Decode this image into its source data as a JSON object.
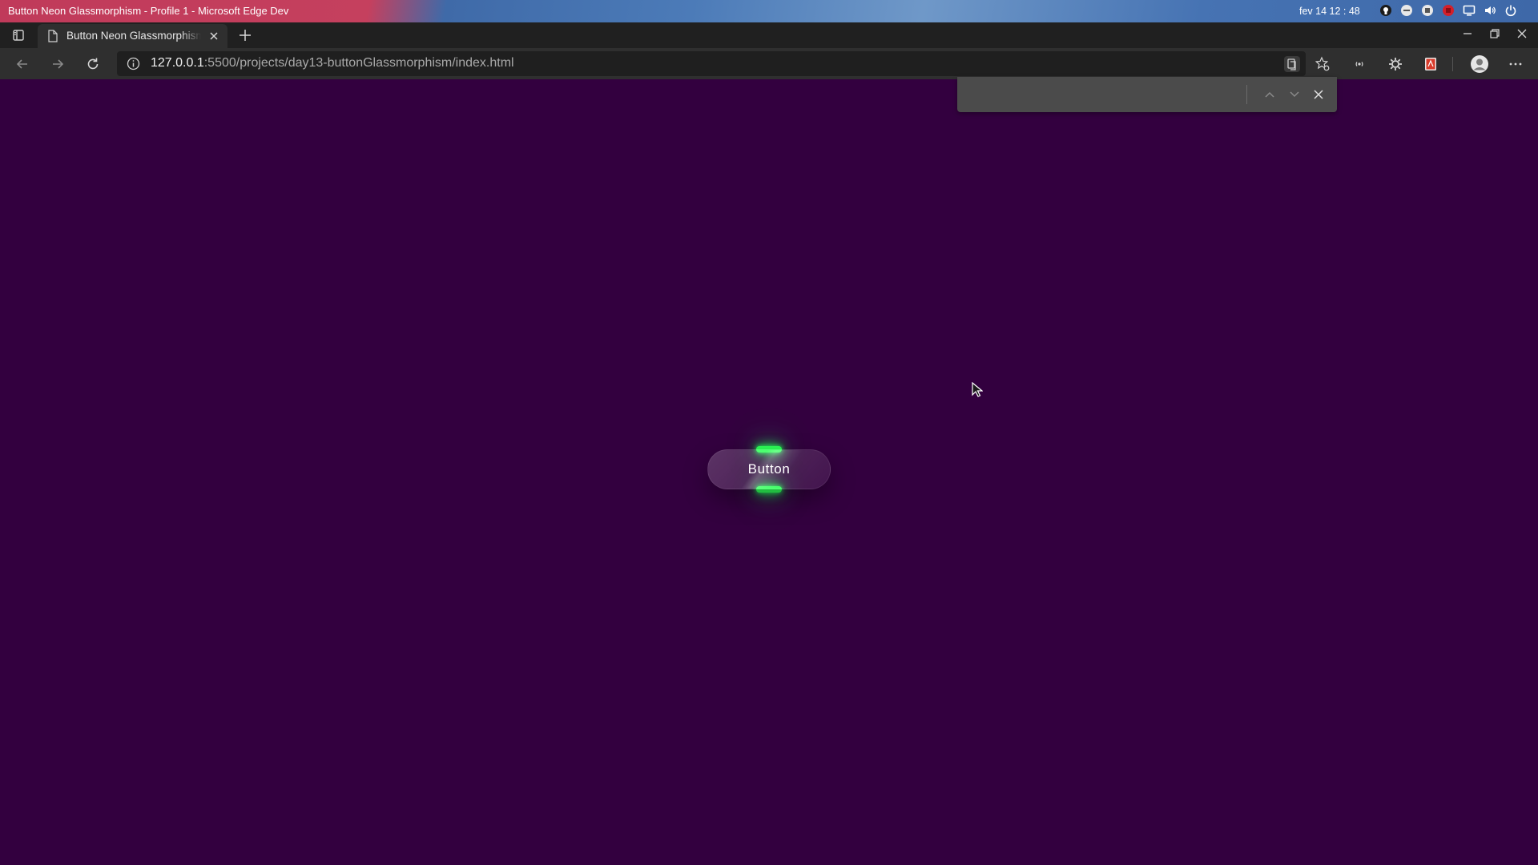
{
  "os": {
    "window_title": "Button Neon Glassmorphism - Profile 1 - Microsoft Edge Dev",
    "clock": "fev 14 12 : 48"
  },
  "browser": {
    "tab": {
      "title": "Button Neon Glassmorphism"
    },
    "address": {
      "host": "127.0.0.1",
      "path": ":5500/projects/day13-buttonGlassmorphism/index.html"
    },
    "find": {
      "value": ""
    }
  },
  "page": {
    "background": "#33003f",
    "button_label": "Button",
    "neon_color": "#2dff57"
  }
}
